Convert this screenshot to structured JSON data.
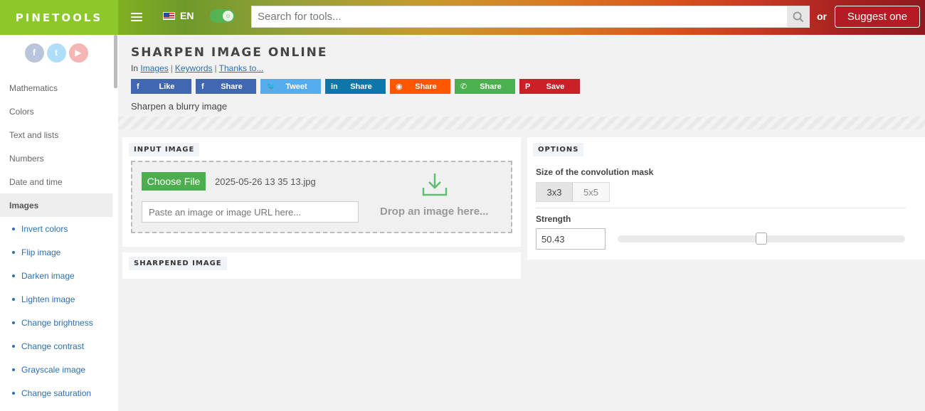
{
  "header": {
    "logo": "PINETOOLS",
    "language": "EN",
    "search_placeholder": "Search for tools...",
    "or_text": "or",
    "suggest_label": "Suggest one"
  },
  "sidebar": {
    "socials": [
      {
        "icon": "facebook-icon",
        "glyph": "f",
        "color": "#3b5998"
      },
      {
        "icon": "twitter-icon",
        "glyph": "t",
        "color": "#1da1f2"
      },
      {
        "icon": "youtube-icon",
        "glyph": "▶",
        "color": "#e52d27"
      }
    ],
    "categories": [
      "Mathematics",
      "Colors",
      "Text and lists",
      "Numbers",
      "Date and time",
      "Images"
    ],
    "active_category": "Images",
    "subitems": [
      "Invert colors",
      "Flip image",
      "Darken image",
      "Lighten image",
      "Change brightness",
      "Change contrast",
      "Grayscale image",
      "Change saturation"
    ]
  },
  "page": {
    "title": "SHARPEN IMAGE ONLINE",
    "breadcrumb_prefix": "In",
    "breadcrumb_links": [
      "Images",
      "Keywords",
      "Thanks to..."
    ],
    "description": "Sharpen a blurry image"
  },
  "share_buttons": [
    {
      "label": "Like",
      "glyph": "f",
      "color": "#4267b2",
      "icon": "facebook-icon"
    },
    {
      "label": "Share",
      "glyph": "f",
      "color": "#4267b2",
      "icon": "facebook-icon"
    },
    {
      "label": "Tweet",
      "glyph": "🐦",
      "color": "#55acee",
      "icon": "twitter-icon"
    },
    {
      "label": "Share",
      "glyph": "in",
      "color": "#0e76a8",
      "icon": "linkedin-icon"
    },
    {
      "label": "Share",
      "glyph": "◉",
      "color": "#ff5700",
      "icon": "reddit-icon"
    },
    {
      "label": "Share",
      "glyph": "✆",
      "color": "#4caf50",
      "icon": "whatsapp-icon"
    },
    {
      "label": "Save",
      "glyph": "P",
      "color": "#cb2027",
      "icon": "pinterest-icon"
    }
  ],
  "input_panel": {
    "label": "INPUT IMAGE",
    "choose_file_label": "Choose File",
    "file_name": "2025-05-26 13 35 13.jpg",
    "url_placeholder": "Paste an image or image URL here...",
    "drop_text": "Drop an image here..."
  },
  "output_panel": {
    "label": "SHARPENED IMAGE"
  },
  "options_panel": {
    "label": "OPTIONS",
    "mask_label": "Size of the convolution mask",
    "mask_options": [
      "3x3",
      "5x5"
    ],
    "mask_selected": "3x3",
    "strength_label": "Strength",
    "strength_value": "50.43",
    "strength_fraction": 0.5
  },
  "colors": {
    "accent_green": "#4cae4f",
    "link_blue": "#2b6fb0",
    "suggest_red": "#b51b24"
  }
}
